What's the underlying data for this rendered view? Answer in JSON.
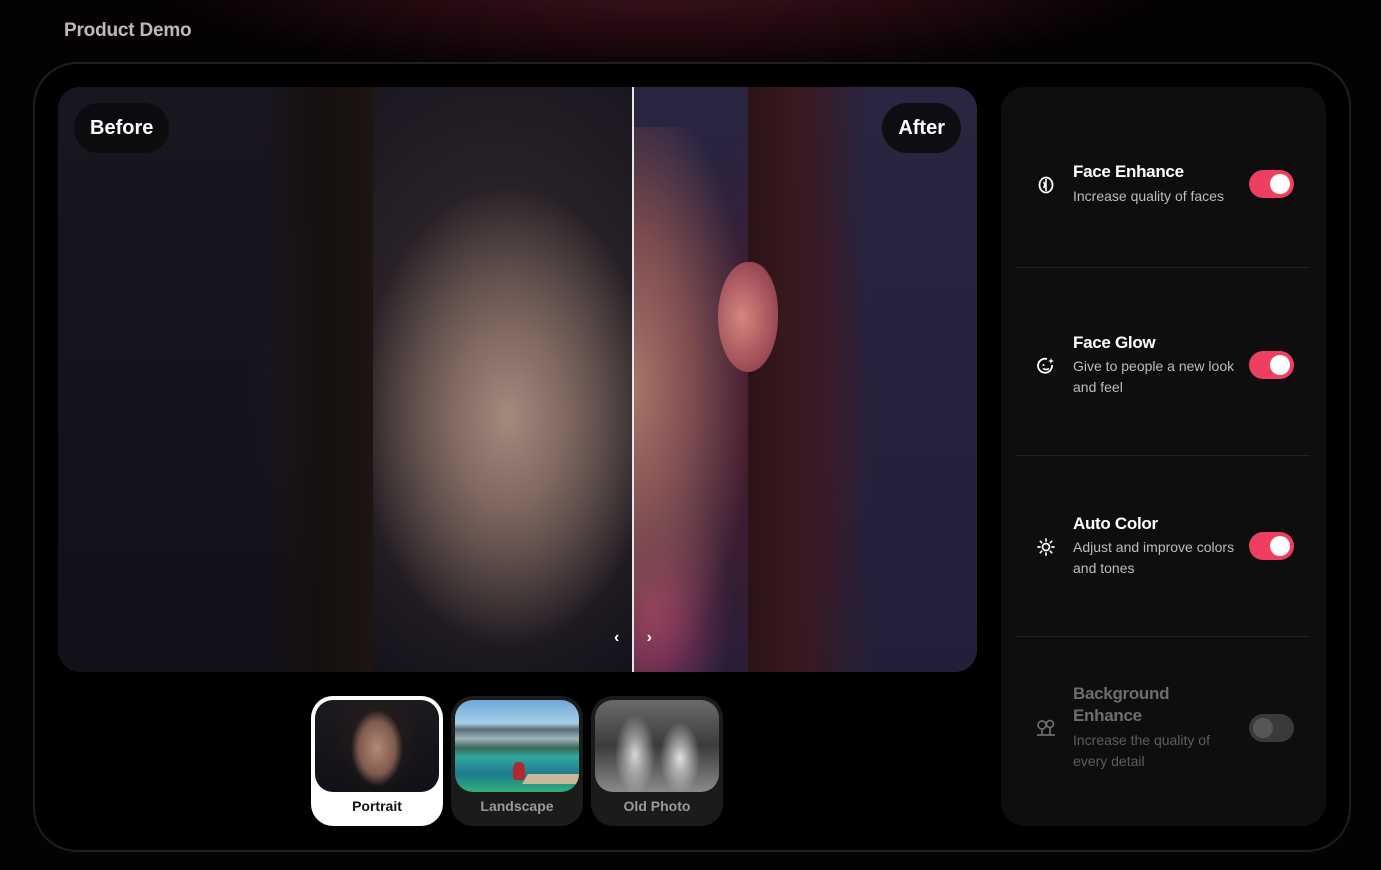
{
  "page": {
    "title": "Product Demo"
  },
  "viewer": {
    "before_label": "Before",
    "after_label": "After",
    "split_position_pct": 62.5
  },
  "samples": [
    {
      "label": "Portrait",
      "active": true
    },
    {
      "label": "Landscape",
      "active": false
    },
    {
      "label": "Old Photo",
      "active": false
    }
  ],
  "settings": [
    {
      "title": "Face Enhance",
      "description": "Increase quality of faces",
      "icon": "face-enhance-icon",
      "enabled": true
    },
    {
      "title": "Face Glow",
      "description": "Give to people a new look and feel",
      "icon": "face-glow-icon",
      "enabled": true
    },
    {
      "title": "Auto Color",
      "description": "Adjust and improve colors and tones",
      "icon": "sun-icon",
      "enabled": true
    },
    {
      "title": "Background Enhance",
      "description": "Increase the quality of every detail",
      "icon": "trees-icon",
      "enabled": false
    }
  ],
  "colors": {
    "accent": "#ee3f60",
    "toggle_off": "#3a3a3a",
    "panel": "#0e0e0e"
  }
}
